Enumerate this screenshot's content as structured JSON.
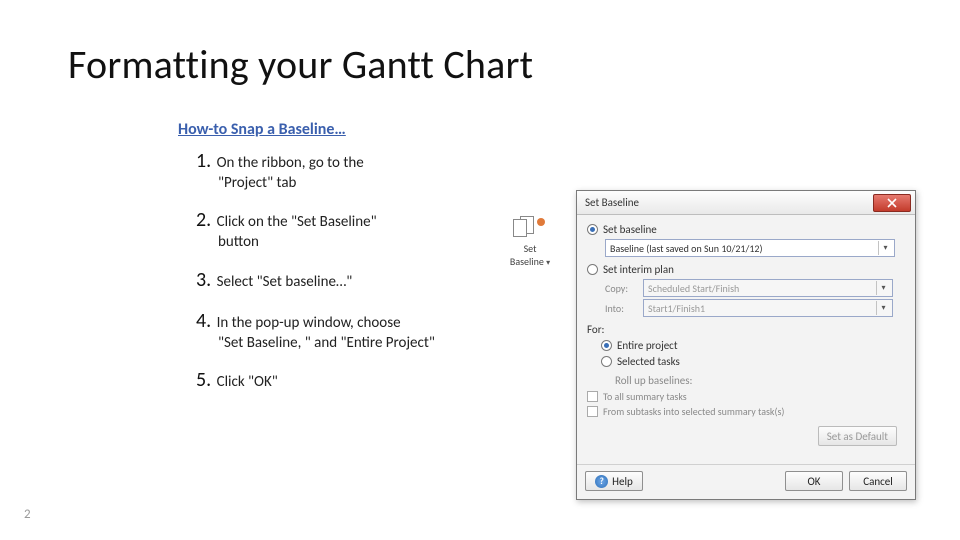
{
  "title": "Formatting your Gantt Chart",
  "subtitle": "How-to Snap a Baseline…",
  "steps": [
    {
      "num": "1.",
      "first": "On the ribbon, go to the",
      "rest": "\"Project\" tab"
    },
    {
      "num": "2.",
      "first": "Click on the \"Set Baseline\"",
      "rest": "button"
    },
    {
      "num": "3.",
      "first": "Select \"Set baseline…\"",
      "rest": ""
    },
    {
      "num": "4.",
      "first": "In the pop-up window, choose",
      "rest": "\"Set Baseline, \" and \"Entire Project\""
    },
    {
      "num": "5.",
      "first": "Click \"OK\"",
      "rest": ""
    }
  ],
  "pageNumber": "2",
  "ribbonButton": {
    "label_line1": "Set",
    "label_line2": "Baseline",
    "dropdown_glyph": "▾"
  },
  "dialog": {
    "title": "Set Baseline",
    "opt_set_baseline": "Set baseline",
    "baseline_value": "Baseline (last saved on Sun 10/21/12)",
    "opt_set_interim": "Set interim plan",
    "copy_label": "Copy:",
    "copy_value": "Scheduled Start/Finish",
    "into_label": "Into:",
    "into_value": "Start1/Finish1",
    "for_label": "For:",
    "opt_entire_project": "Entire project",
    "opt_selected_tasks": "Selected tasks",
    "rollup_label": "Roll up baselines:",
    "chk_to_all": "To all summary tasks",
    "chk_from_sub": "From subtasks into selected summary task(s)",
    "btn_set_default": "Set as Default",
    "btn_help": "Help",
    "btn_ok": "OK",
    "btn_cancel": "Cancel"
  }
}
